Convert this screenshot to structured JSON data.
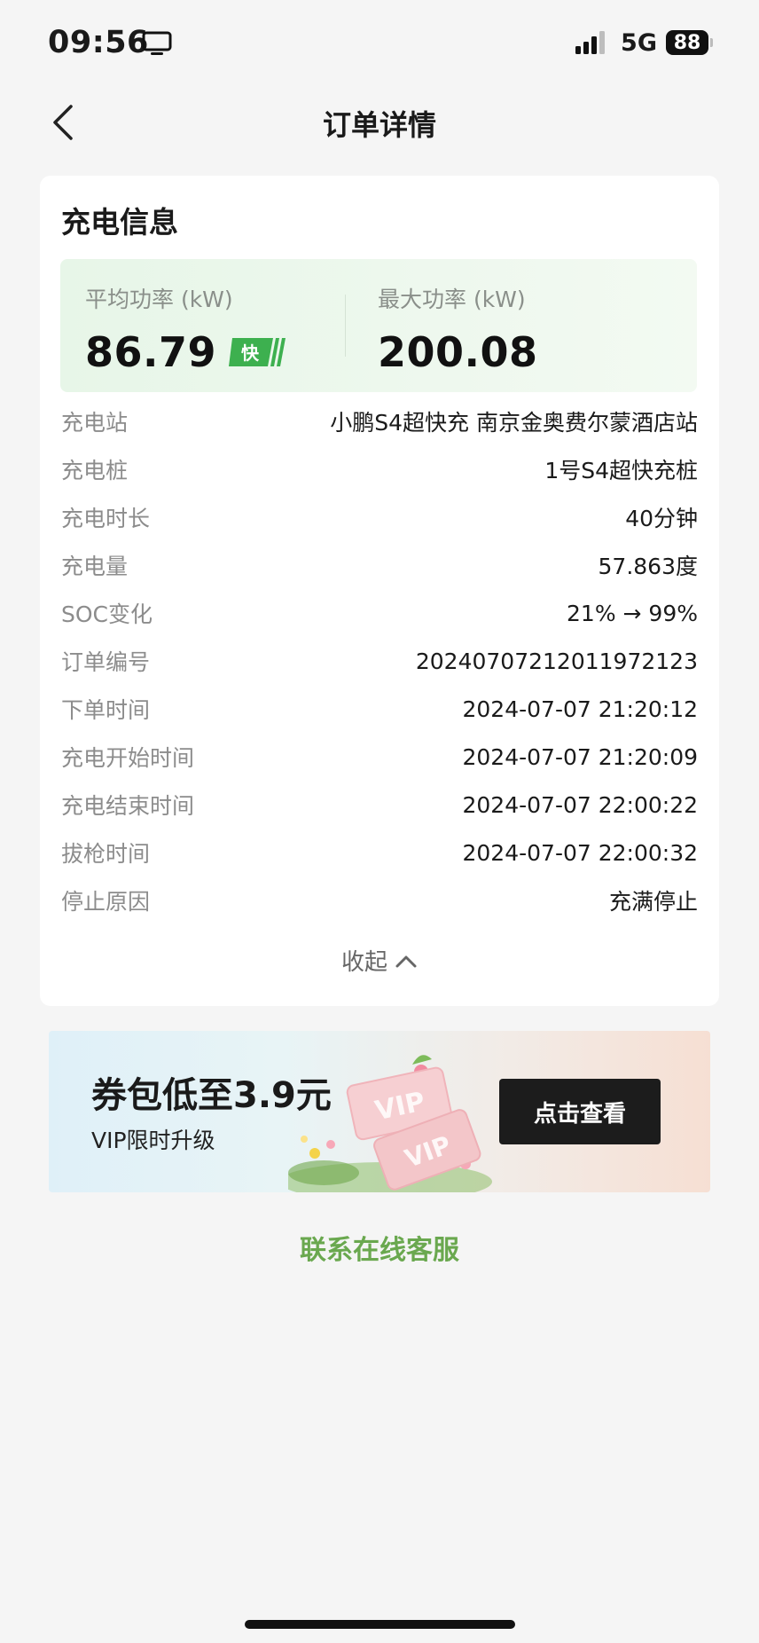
{
  "status_bar": {
    "time": "09:56",
    "network": "5G",
    "battery": "88",
    "icons": [
      "screen-mirror-icon",
      "signal-icon",
      "battery-icon"
    ]
  },
  "nav": {
    "title": "订单详情",
    "back_icon": "chevron-left-icon"
  },
  "card": {
    "title": "充电信息",
    "avg_power": {
      "label": "平均功率 (kW)",
      "value": "86.79",
      "badge": "快"
    },
    "max_power": {
      "label": "最大功率 (kW)",
      "value": "200.08"
    },
    "rows": [
      {
        "label": "充电站",
        "value": "小鹏S4超快充 南京金奥费尔蒙酒店站"
      },
      {
        "label": "充电桩",
        "value": "1号S4超快充桩"
      },
      {
        "label": "充电时长",
        "value": "40分钟"
      },
      {
        "label": "充电量",
        "value": "57.863度"
      },
      {
        "label": "SOC变化",
        "value": "21% → 99%"
      },
      {
        "label": "订单编号",
        "value": "20240707212011972123"
      },
      {
        "label": "下单时间",
        "value": "2024-07-07 21:20:12"
      },
      {
        "label": "充电开始时间",
        "value": "2024-07-07 21:20:09"
      },
      {
        "label": "充电结束时间",
        "value": "2024-07-07 22:00:22"
      },
      {
        "label": "拔枪时间",
        "value": "2024-07-07 22:00:32"
      },
      {
        "label": "停止原因",
        "value": "充满停止"
      }
    ],
    "collapse_label": "收起"
  },
  "banner": {
    "title": "券包低至3.9元",
    "subtitle": "VIP限时升级",
    "art_text": "VIP",
    "button": "点击查看"
  },
  "contact": "联系在线客服",
  "colors": {
    "accent_green": "#6aa84f",
    "badge_green": "#3db04f",
    "background": "#f5f5f5"
  }
}
